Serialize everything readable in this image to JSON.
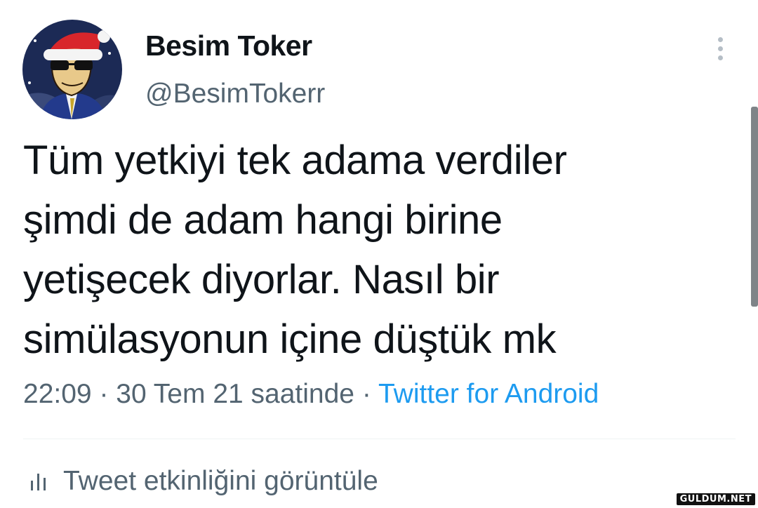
{
  "author": {
    "display_name": "Besim Toker",
    "handle": "@BesimTokerr",
    "avatar_icon": "avatar-santa-hat-cartoon"
  },
  "tweet": {
    "text_lines": [
      "Tüm yetkiyi tek adama verdiler",
      "şimdi de adam hangi birine",
      "yetişecek diyorlar. Nasıl bir",
      "simülasyonun içine düştük mk"
    ],
    "time": "22:09",
    "date": "30 Tem 21 saatinde",
    "separator": "·",
    "source": "Twitter for Android"
  },
  "actions": {
    "view_activity_label": "Tweet etkinliğini görüntüle",
    "more_icon": "more-vertical-icon",
    "activity_icon": "bar-chart-icon"
  },
  "watermark": {
    "text": "GULDUM.NET"
  },
  "colors": {
    "text_primary": "#0f1419",
    "text_secondary": "#536471",
    "link": "#1d9bf0",
    "divider": "#eff3f4"
  }
}
